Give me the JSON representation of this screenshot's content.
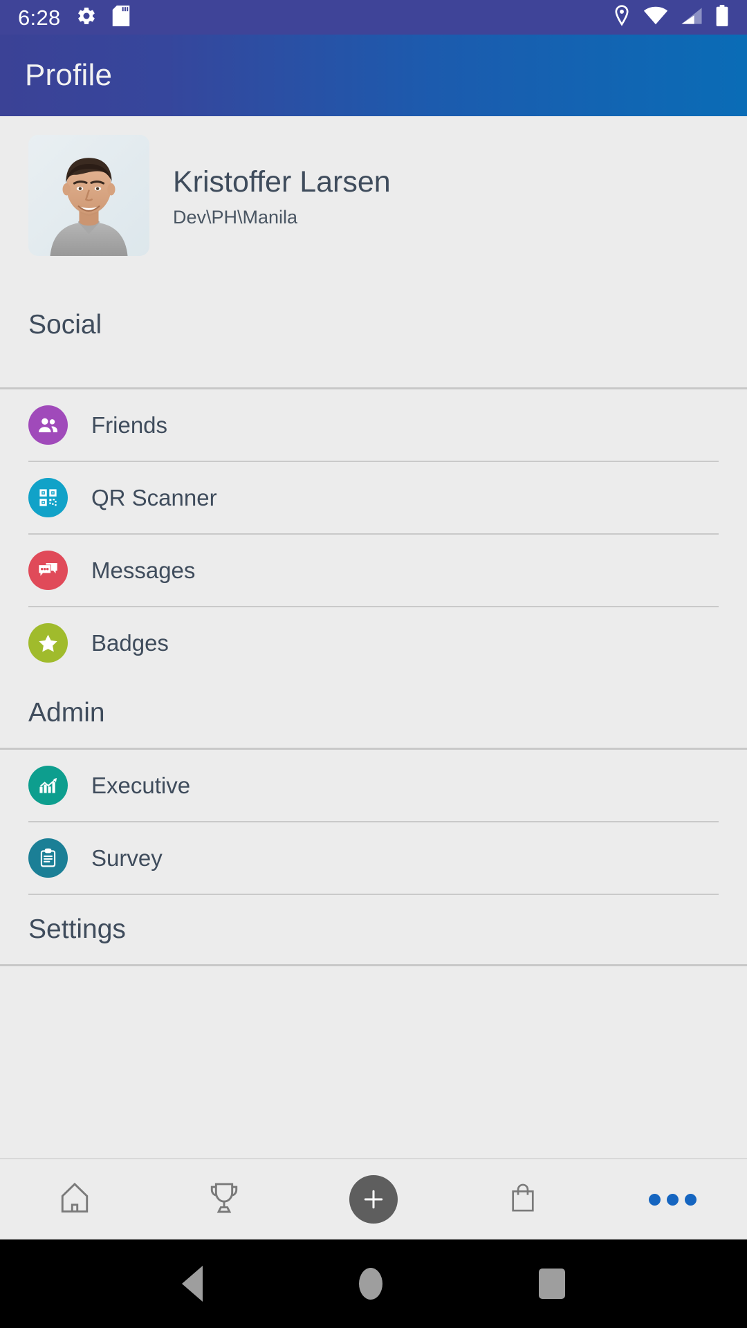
{
  "status_bar": {
    "time": "6:28",
    "left_icons": [
      "gear-icon",
      "sd-card-icon"
    ],
    "right_icons": [
      "location-pin-icon",
      "wifi-icon",
      "cellular-signal-icon",
      "battery-icon"
    ],
    "background_color": "#3f4498"
  },
  "app_bar": {
    "title": "Profile",
    "gradient_start": "#3b4296",
    "gradient_end": "#0a6cb6"
  },
  "profile": {
    "name": "Kristoffer Larsen",
    "subtitle": "Dev\\PH\\Manila",
    "avatar_alt": "profile-photo"
  },
  "sections": [
    {
      "id": "social",
      "title": "Social",
      "items": [
        {
          "label": "Friends",
          "icon": "people-group-icon",
          "color": "#a04aba"
        },
        {
          "label": "QR Scanner",
          "icon": "qr-code-icon",
          "color": "#11a2c8"
        },
        {
          "label": "Messages",
          "icon": "chat-bubbles-icon",
          "color": "#e04a59"
        },
        {
          "label": "Badges",
          "icon": "star-icon",
          "color": "#a0bb2c"
        }
      ]
    },
    {
      "id": "admin",
      "title": "Admin",
      "items": [
        {
          "label": "Executive",
          "icon": "bar-chart-trend-icon",
          "color": "#0d9e8e"
        },
        {
          "label": "Survey",
          "icon": "clipboard-icon",
          "color": "#1b7f96"
        }
      ]
    },
    {
      "id": "settings",
      "title": "Settings",
      "items": []
    }
  ],
  "tab_bar": {
    "tabs": [
      {
        "id": "home",
        "icon": "home-icon"
      },
      {
        "id": "awards",
        "icon": "trophy-icon"
      },
      {
        "id": "add",
        "icon": "plus-icon"
      },
      {
        "id": "shop",
        "icon": "shopping-bag-icon"
      },
      {
        "id": "more",
        "icon": "more-dots-icon"
      }
    ],
    "accent_color": "#1565c0",
    "fab_color": "#5e5e5e"
  },
  "android_nav": {
    "buttons": [
      "back-icon",
      "home-icon",
      "recents-icon"
    ]
  },
  "colors": {
    "page_background": "#ececec",
    "text_primary": "#3f4c5c",
    "divider": "#c9c9c9"
  }
}
